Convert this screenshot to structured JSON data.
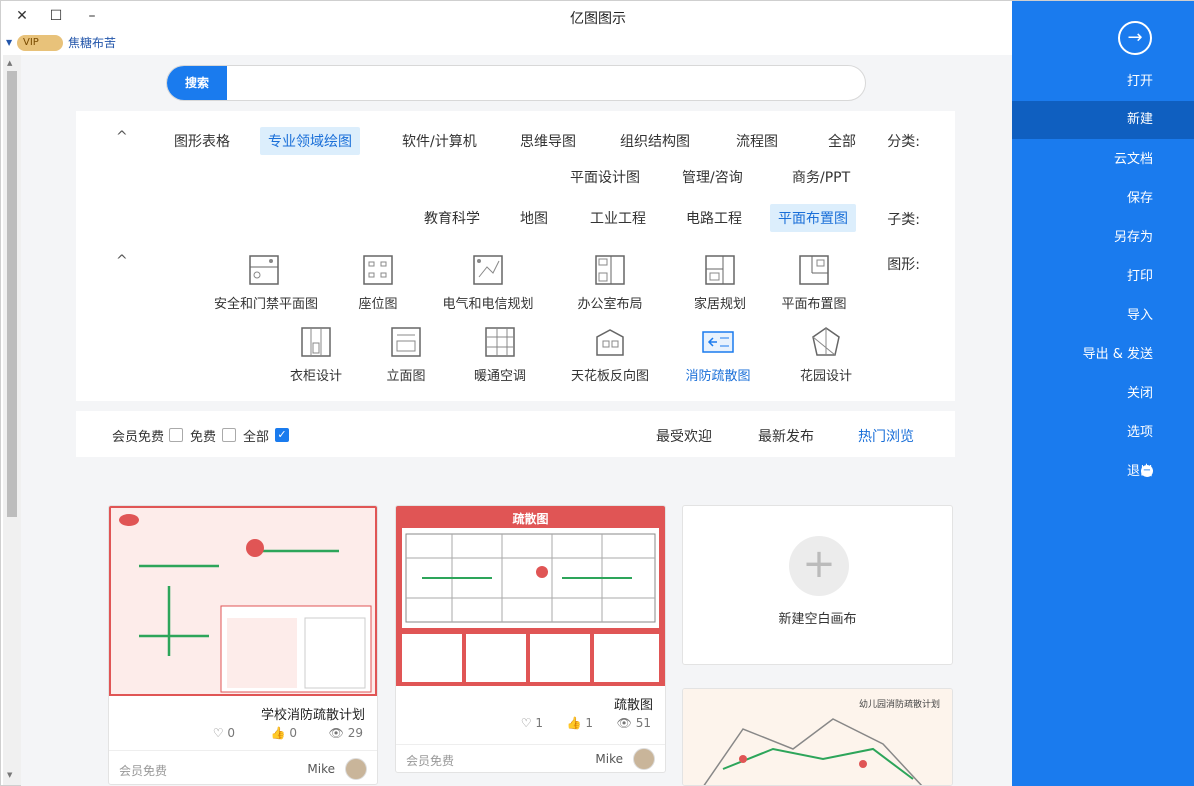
{
  "window": {
    "title": "亿图图示",
    "close_icon": "✕",
    "maximize_icon": "☐",
    "minimize_icon": "–"
  },
  "user": {
    "vip_label": "VIP",
    "name": "焦糖布苦"
  },
  "search": {
    "button_label": "搜索",
    "placeholder": "",
    "value": ""
  },
  "filters": {
    "category_label": "分类:",
    "categories": [
      "全部",
      "流程图",
      "组织结构图",
      "思维导图",
      "软件/计算机",
      "专业领域绘图",
      "图形表格",
      "商务/PPT",
      "管理/咨询",
      "平面设计图"
    ],
    "active_category": "专业领域绘图",
    "subcategory_label": "子类:",
    "subcategories": [
      "平面布置图",
      "电路工程",
      "工业工程",
      "地图",
      "教育科学"
    ],
    "active_subcategory": "平面布置图",
    "shape_label": "图形:",
    "collapse_icon": "^"
  },
  "templates": [
    {
      "label": "平面布置图",
      "icon": "floorplan-icon"
    },
    {
      "label": "家居规划",
      "icon": "home-plan-icon"
    },
    {
      "label": "办公室布局",
      "icon": "office-layout-icon"
    },
    {
      "label": "电气和电信规划",
      "icon": "electrical-plan-icon"
    },
    {
      "label": "座位图",
      "icon": "seating-icon"
    },
    {
      "label": "安全和门禁平面图",
      "icon": "security-plan-icon"
    },
    {
      "label": "花园设计",
      "icon": "garden-icon"
    },
    {
      "label": "消防疏散图",
      "icon": "fire-evacuation-icon"
    },
    {
      "label": "天花板反向图",
      "icon": "ceiling-icon"
    },
    {
      "label": "暖通空调",
      "icon": "hvac-icon"
    },
    {
      "label": "立面图",
      "icon": "elevation-icon"
    },
    {
      "label": "衣柜设计",
      "icon": "wardrobe-icon"
    }
  ],
  "active_template": "消防疏散图",
  "sort": {
    "tabs": [
      "热门浏览",
      "最新发布",
      "最受欢迎"
    ],
    "active": "热门浏览",
    "filter_options": [
      {
        "label": "全部",
        "checked": true
      },
      {
        "label": "免费",
        "checked": false
      },
      {
        "label": "会员免费",
        "checked": false
      }
    ]
  },
  "cards": [
    {
      "type": "new",
      "label": "新建空白画布"
    },
    {
      "title": "疏散图",
      "views": "51",
      "likes": "1",
      "hearts": "1",
      "author": "Mike",
      "price": "会员免费",
      "thumb_header": "疏散图"
    },
    {
      "title": "学校消防疏散计划",
      "views": "29",
      "likes": "0",
      "hearts": "0",
      "author": "Mike",
      "price": "会员免费"
    },
    {
      "title": "幼儿园消防疏散计划",
      "type": "partial"
    }
  ],
  "sidebar": {
    "back_icon": "→",
    "items": [
      "打开",
      "新建",
      "云文档",
      "保存",
      "另存为",
      "打印",
      "导入",
      "导出 & 发送",
      "关闭",
      "选项",
      "退出"
    ],
    "active": "新建"
  },
  "colors": {
    "accent": "#1a7bee",
    "sidebar": "#1a7bee",
    "sidebar_active": "#0f5fc0",
    "evac_red": "#e05555"
  }
}
